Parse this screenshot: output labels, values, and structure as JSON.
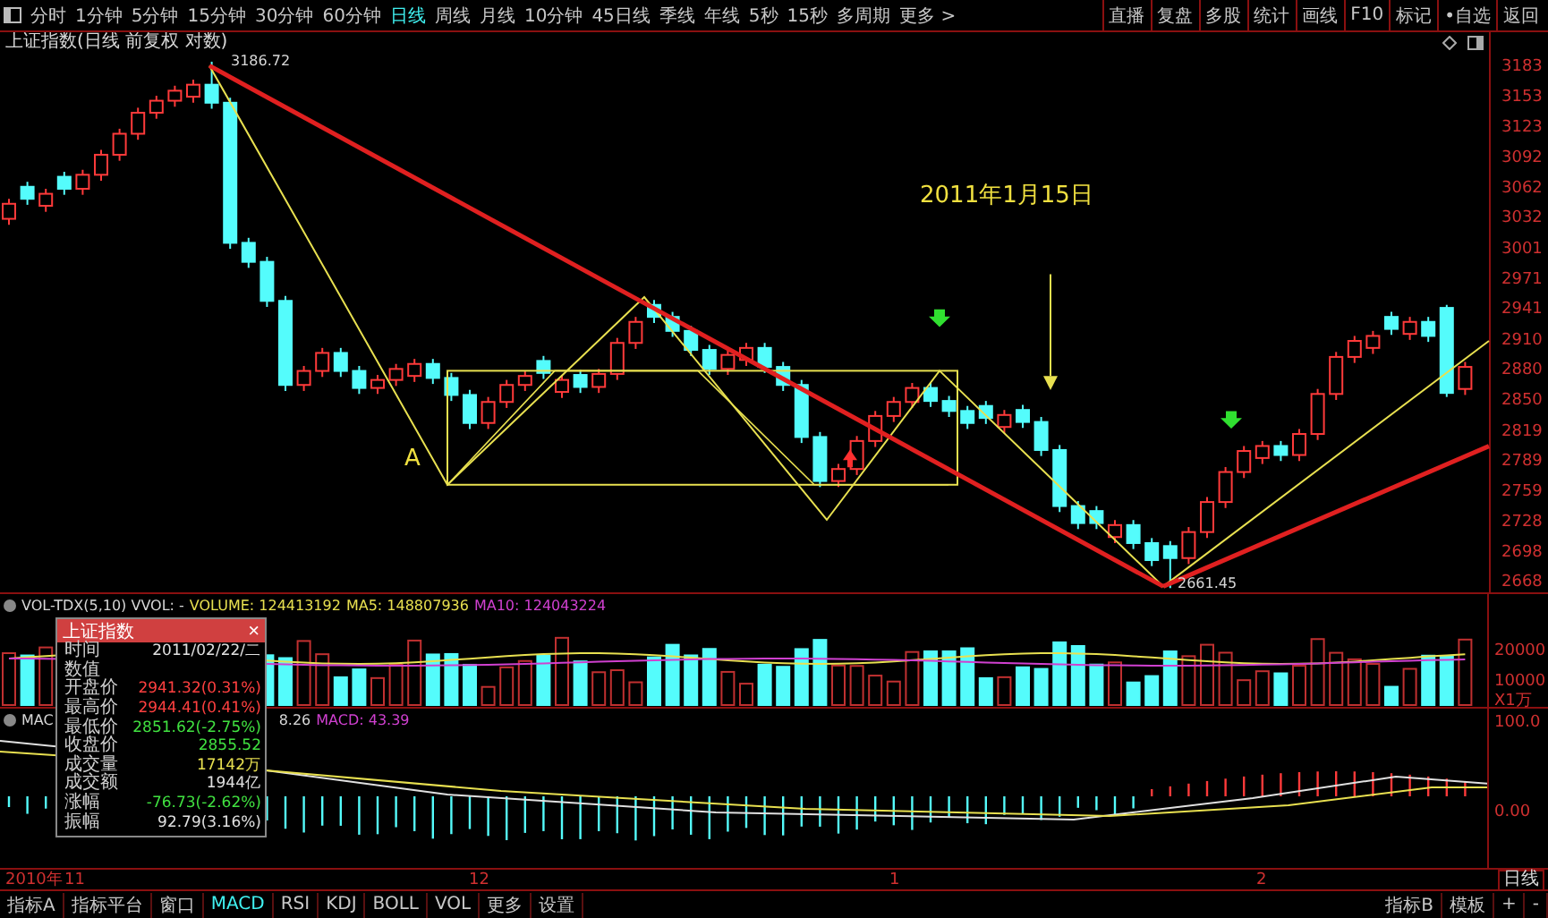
{
  "toolbar": {
    "periods": [
      {
        "label": "分时",
        "selected": false
      },
      {
        "label": "1分钟",
        "selected": false
      },
      {
        "label": "5分钟",
        "selected": false
      },
      {
        "label": "15分钟",
        "selected": false
      },
      {
        "label": "30分钟",
        "selected": false
      },
      {
        "label": "60分钟",
        "selected": false
      },
      {
        "label": "日线",
        "selected": true
      },
      {
        "label": "周线",
        "selected": false
      },
      {
        "label": "月线",
        "selected": false
      },
      {
        "label": "10分钟",
        "selected": false
      },
      {
        "label": "45日线",
        "selected": false
      },
      {
        "label": "季线",
        "selected": false
      },
      {
        "label": "年线",
        "selected": false
      },
      {
        "label": "5秒",
        "selected": false
      },
      {
        "label": "15秒",
        "selected": false
      },
      {
        "label": "多周期",
        "selected": false
      },
      {
        "label": "更多 >",
        "selected": false
      }
    ],
    "buttons": [
      "直播",
      "复盘",
      "多股",
      "统计",
      "画线",
      "F10",
      "标记",
      "•自选",
      "返回"
    ]
  },
  "chart_title": "上证指数(日线 前复权 对数)",
  "main_chart": {
    "high_label": "3186.72",
    "low_label": "2661.45",
    "date_note": "2011年1月15日",
    "point_label": "A",
    "chart_data": {
      "type": "candlestick",
      "ylim": [
        2655,
        3195
      ],
      "yticks": [
        3183,
        3153,
        3123,
        3092,
        3062,
        3032,
        3001,
        2971,
        2941,
        2910,
        2880,
        2850,
        2819,
        2789,
        2759,
        2728,
        2698,
        2668
      ],
      "ohlc": [
        [
          3030,
          3050,
          3024,
          3045
        ],
        [
          3062,
          3067,
          3044,
          3050
        ],
        [
          3043,
          3060,
          3037,
          3055
        ],
        [
          3072,
          3077,
          3054,
          3060
        ],
        [
          3060,
          3079,
          3054,
          3074
        ],
        [
          3074,
          3099,
          3068,
          3094
        ],
        [
          3094,
          3120,
          3088,
          3115
        ],
        [
          3115,
          3141,
          3109,
          3136
        ],
        [
          3136,
          3153,
          3130,
          3148
        ],
        [
          3148,
          3163,
          3142,
          3158
        ],
        [
          3152,
          3169,
          3146,
          3164
        ],
        [
          3164,
          3187,
          3140,
          3146
        ],
        [
          3146,
          3151,
          3000,
          3006
        ],
        [
          3006,
          3011,
          2981,
          2987
        ],
        [
          2987,
          2992,
          2942,
          2948
        ],
        [
          2948,
          2953,
          2858,
          2864
        ],
        [
          2864,
          2883,
          2858,
          2878
        ],
        [
          2878,
          2901,
          2872,
          2896
        ],
        [
          2896,
          2901,
          2872,
          2878
        ],
        [
          2878,
          2883,
          2855,
          2861
        ],
        [
          2861,
          2874,
          2855,
          2869
        ],
        [
          2869,
          2885,
          2863,
          2880
        ],
        [
          2873,
          2890,
          2867,
          2885
        ],
        [
          2885,
          2890,
          2865,
          2871
        ],
        [
          2871,
          2876,
          2848,
          2854
        ],
        [
          2854,
          2859,
          2820,
          2826
        ],
        [
          2826,
          2852,
          2820,
          2847
        ],
        [
          2847,
          2869,
          2841,
          2864
        ],
        [
          2864,
          2878,
          2858,
          2873
        ],
        [
          2888,
          2893,
          2870,
          2876
        ],
        [
          2857,
          2874,
          2851,
          2869
        ],
        [
          2874,
          2879,
          2856,
          2862
        ],
        [
          2862,
          2880,
          2856,
          2875
        ],
        [
          2875,
          2911,
          2869,
          2906
        ],
        [
          2906,
          2932,
          2900,
          2927
        ],
        [
          2944,
          2949,
          2926,
          2932
        ],
        [
          2932,
          2937,
          2912,
          2918
        ],
        [
          2918,
          2923,
          2893,
          2899
        ],
        [
          2899,
          2904,
          2874,
          2880
        ],
        [
          2880,
          2899,
          2874,
          2894
        ],
        [
          2889,
          2906,
          2883,
          2901
        ],
        [
          2901,
          2906,
          2876,
          2882
        ],
        [
          2882,
          2887,
          2858,
          2864
        ],
        [
          2864,
          2869,
          2806,
          2812
        ],
        [
          2812,
          2817,
          2762,
          2768
        ],
        [
          2768,
          2785,
          2762,
          2780
        ],
        [
          2780,
          2813,
          2774,
          2808
        ],
        [
          2808,
          2838,
          2802,
          2833
        ],
        [
          2833,
          2852,
          2827,
          2847
        ],
        [
          2847,
          2866,
          2841,
          2861
        ],
        [
          2861,
          2866,
          2842,
          2848
        ],
        [
          2848,
          2853,
          2832,
          2838
        ],
        [
          2838,
          2843,
          2820,
          2826
        ],
        [
          2843,
          2848,
          2825,
          2831
        ],
        [
          2822,
          2839,
          2816,
          2834
        ],
        [
          2839,
          2844,
          2821,
          2827
        ],
        [
          2827,
          2832,
          2793,
          2799
        ],
        [
          2799,
          2804,
          2737,
          2743
        ],
        [
          2743,
          2748,
          2720,
          2726
        ],
        [
          2738,
          2743,
          2720,
          2726
        ],
        [
          2712,
          2729,
          2706,
          2724
        ],
        [
          2724,
          2729,
          2700,
          2706
        ],
        [
          2706,
          2711,
          2683,
          2689
        ],
        [
          2703,
          2708,
          2661,
          2691
        ],
        [
          2691,
          2722,
          2685,
          2717
        ],
        [
          2717,
          2752,
          2711,
          2747
        ],
        [
          2747,
          2782,
          2741,
          2777
        ],
        [
          2777,
          2803,
          2771,
          2798
        ],
        [
          2791,
          2808,
          2785,
          2803
        ],
        [
          2803,
          2808,
          2788,
          2794
        ],
        [
          2794,
          2820,
          2788,
          2815
        ],
        [
          2815,
          2860,
          2809,
          2855
        ],
        [
          2855,
          2897,
          2849,
          2892
        ],
        [
          2892,
          2913,
          2886,
          2908
        ],
        [
          2901,
          2918,
          2895,
          2913
        ],
        [
          2932,
          2937,
          2914,
          2920
        ],
        [
          2915,
          2932,
          2909,
          2927
        ],
        [
          2927,
          2932,
          2907,
          2913
        ],
        [
          2941,
          2944,
          2852,
          2856
        ],
        [
          2860,
          2887,
          2854,
          2882
        ]
      ]
    }
  },
  "volume_panel": {
    "header": [
      {
        "text": "VOL-TDX(5,10) VVOL: -",
        "color": "#d8d8d8"
      },
      {
        "text": "VOLUME: 124413192",
        "color": "#e8e050"
      },
      {
        "text": "MA5: 148807936",
        "color": "#e8e050"
      },
      {
        "text": "MA10: 124043224",
        "color": "#d040d0"
      }
    ],
    "y_axis": [
      "20000",
      "10000"
    ],
    "unit": "X1万"
  },
  "macd_panel": {
    "header_left": "MAC",
    "header": [
      {
        "text": "8.26",
        "color": "#d8d8d8"
      },
      {
        "text": "MACD: 43.39",
        "color": "#d040d0"
      }
    ],
    "y_axis": [
      "100.0",
      "0.00"
    ]
  },
  "date_axis": {
    "year": "2010年",
    "months": [
      "11",
      "12",
      "1",
      "2"
    ],
    "period_button": "日线"
  },
  "bottom_bar": {
    "tabs": [
      {
        "label": "指标A",
        "selected": false
      },
      {
        "label": "指标平台",
        "selected": false
      },
      {
        "label": "窗口",
        "selected": false
      },
      {
        "label": "MACD",
        "selected": true
      },
      {
        "label": "RSI",
        "selected": false
      },
      {
        "label": "KDJ",
        "selected": false
      },
      {
        "label": "BOLL",
        "selected": false
      },
      {
        "label": "VOL",
        "selected": false
      },
      {
        "label": "更多",
        "selected": false
      },
      {
        "label": "设置",
        "selected": false
      }
    ],
    "right": [
      "指标B",
      "模板",
      "+",
      "-"
    ]
  },
  "popup": {
    "title": "上证指数",
    "close": "×",
    "rows": [
      {
        "label": "时间",
        "value": "2011/02/22/二",
        "color": "#e0e0e0"
      },
      {
        "label": "数值"
      },
      {
        "label": "开盘价",
        "value": "2941.32(0.31%)",
        "color": "#ff4040"
      },
      {
        "label": "最高价",
        "value": "2944.41(0.41%)",
        "color": "#ff4040"
      },
      {
        "label": "最低价",
        "value": "2851.62(-2.75%)",
        "color": "#40e040"
      },
      {
        "label": "收盘价",
        "value": "2855.52",
        "color": "#40e040"
      },
      {
        "label": "成交量",
        "value": "17142万",
        "color": "#e8e050"
      },
      {
        "label": "成交额",
        "value": "1944亿",
        "color": "#e0e0e0"
      },
      {
        "label": "涨幅",
        "value": "-76.73(-2.62%)",
        "color": "#40e040"
      },
      {
        "label": "振幅",
        "value": "92.79(3.16%)",
        "color": "#e0e0e0"
      }
    ]
  }
}
